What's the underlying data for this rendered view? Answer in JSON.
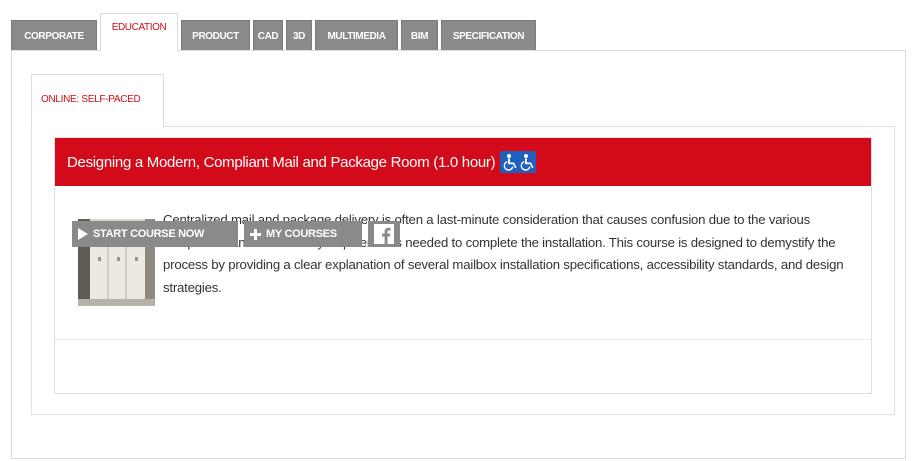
{
  "tabs": {
    "corporate": "CORPORATE",
    "education": "EDUCATION",
    "product": "PRODUCT",
    "cad": "CAD",
    "sd": "3D",
    "multimedia": "MULTIMEDIA",
    "bim": "BIM",
    "specification": "SPECIFICATION",
    "active": "EDUCATION"
  },
  "sub_tab": {
    "label": "ONLINE: SELF-PACED"
  },
  "course": {
    "title": "Designing a Modern, Compliant Mail and Package Room (1.0 hour)",
    "description": "Centralized mail and package delivery is often a last-minute consideration that causes confusion due to the various compliance and accessibility requirements needed to complete the installation. This course is designed to demystify the process by providing a clear explanation of several mailbox installation specifications, accessibility standards, and design strategies.",
    "accessibility_icon": "wheelchair-icon"
  },
  "buttons": {
    "start": "START COURSE NOW",
    "my_courses": "MY COURSES",
    "facebook_icon": "facebook-icon"
  },
  "colors": {
    "brand_red": "#d30a1a",
    "tab_gray": "#8a8a8a",
    "access_blue": "#1f5fbf"
  }
}
